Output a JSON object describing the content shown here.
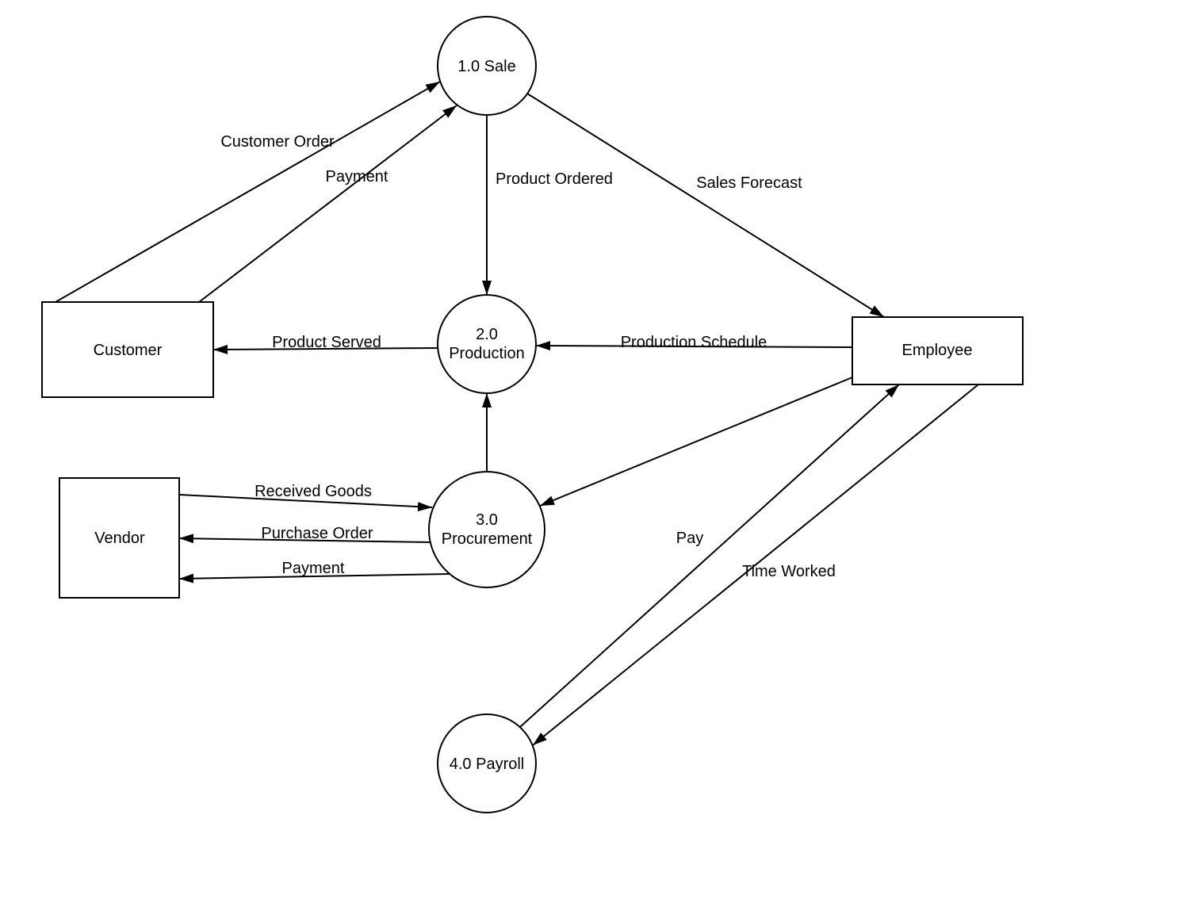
{
  "nodes": {
    "customer": {
      "label": "Customer"
    },
    "vendor": {
      "label": "Vendor"
    },
    "employee": {
      "label": "Employee"
    },
    "sale": {
      "label_line1": "1.0 Sale"
    },
    "production": {
      "label_line1": "2.0",
      "label_line2": "Production"
    },
    "procurement": {
      "label_line1": "3.0",
      "label_line2": "Procurement"
    },
    "payroll": {
      "label_line1": "4.0 Payroll"
    }
  },
  "edges": {
    "customer_order": {
      "label": "Customer Order"
    },
    "payment_to_sale": {
      "label": "Payment"
    },
    "sales_forecast": {
      "label": "Sales Forecast"
    },
    "product_ordered": {
      "label": "Product Ordered"
    },
    "product_served": {
      "label": "Product Served"
    },
    "production_schedule": {
      "label": "Production Schedule"
    },
    "received_goods": {
      "label": "Received Goods"
    },
    "purchase_order": {
      "label": "Purchase Order"
    },
    "payment_to_vendor": {
      "label": "Payment"
    },
    "pay": {
      "label": "Pay"
    },
    "time_worked": {
      "label": "Time Worked"
    }
  }
}
